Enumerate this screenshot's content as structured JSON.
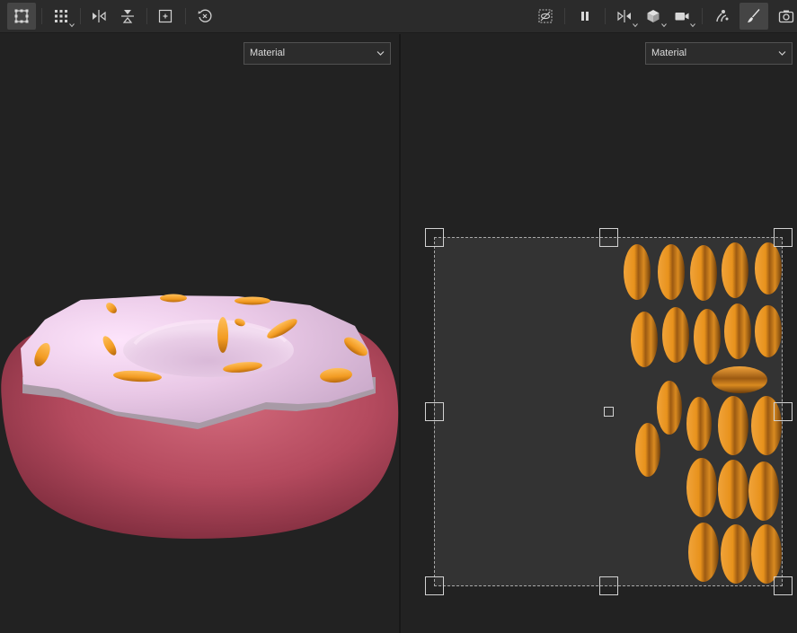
{
  "toolbar": {
    "left_tools": [
      "selection-tool-icon",
      "grid-select-icon",
      "flip-horizontal-icon",
      "flip-vertical-icon",
      "fit-icon",
      "reset-view-icon"
    ],
    "right_tools": [
      "hide-icon",
      "pause-icon",
      "symmetry-icon",
      "cube-icon",
      "camera-icon",
      "bake-icon",
      "brush-icon",
      "screenshot-icon"
    ],
    "active_tools": [
      "selection-tool-icon",
      "brush-icon"
    ]
  },
  "viewport_3d": {
    "channel_label": "Material"
  },
  "viewport_uv": {
    "channel_label": "Material"
  },
  "colors": {
    "toolbar_bg": "#2b2b2b",
    "viewport_bg": "#222222",
    "uv_frame_bg": "#333333",
    "donut_dough": "#b84a5f",
    "donut_icing": "#e6c6e3",
    "sprinkle": "#f2a02a"
  }
}
